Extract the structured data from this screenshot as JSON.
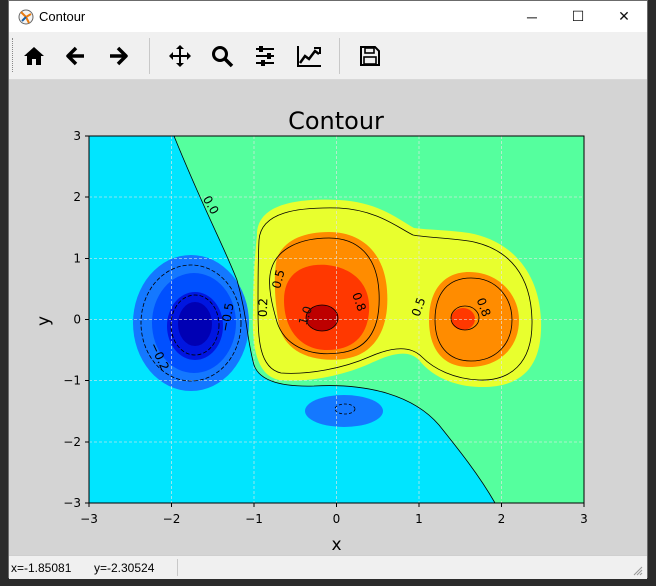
{
  "window": {
    "title": "Contour",
    "minimize": "─",
    "maximize": "☐",
    "close": "✕"
  },
  "toolbar": {
    "buttons": [
      {
        "name": "home-icon",
        "tooltip": ""
      },
      {
        "name": "back-arrow-icon",
        "tooltip": ""
      },
      {
        "name": "forward-arrow-icon",
        "tooltip": ""
      },
      {
        "name": "pan-icon",
        "tooltip": ""
      },
      {
        "name": "zoom-icon",
        "tooltip": ""
      },
      {
        "name": "configure-subplots-icon",
        "tooltip": ""
      },
      {
        "name": "edit-axis-icon",
        "tooltip": ""
      },
      {
        "name": "save-icon",
        "tooltip": ""
      }
    ]
  },
  "status": {
    "x": "x=-1.85081",
    "y": "y=-2.30524"
  },
  "colors": {
    "cyan": "#00e5ff",
    "green": "#55ff9e",
    "yellow": "#e8ff2e",
    "orange": "#ff8c00",
    "red": "#d40000",
    "blue": "#0050ff"
  },
  "chart_data": {
    "type": "contour",
    "title": "Contour",
    "xlabel": "x",
    "ylabel": "y",
    "xlim": [
      -3,
      3
    ],
    "ylim": [
      -3,
      3
    ],
    "xticks": [
      "−3",
      "−2",
      "−1",
      "0",
      "1",
      "2",
      "3"
    ],
    "yticks": [
      "3",
      "2",
      "1",
      "0",
      "−1",
      "−2",
      "−3"
    ],
    "grid": true,
    "contour_labels": [
      "0.0",
      "0.5",
      "0.2",
      "0.8",
      "1.0",
      "0.5",
      "0.8",
      "−0.5",
      "−0.2"
    ],
    "features": [
      {
        "kind": "peak",
        "center": [
          -0.2,
          0.0
        ]
      },
      {
        "kind": "peak",
        "center": [
          1.55,
          0.0
        ]
      },
      {
        "kind": "trough",
        "center": [
          -1.7,
          -0.05
        ]
      },
      {
        "kind": "trough",
        "center": [
          0.1,
          -1.5
        ]
      }
    ]
  }
}
